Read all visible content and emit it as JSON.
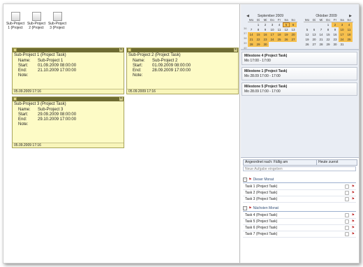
{
  "window": {
    "title": ""
  },
  "projects": [
    {
      "name": "Sub-Project 1 (Project"
    },
    {
      "name": "Sub-Project 2 (Project"
    },
    {
      "name": "Sub-Project 3 (Project"
    }
  ],
  "notes": [
    {
      "title": "Sub-Project 1 (Project Task)",
      "name_label": "Name:",
      "name": "Sub-Project 1",
      "start_label": "Start:",
      "start": "01.09.2009 08:00:00",
      "end_label": "End:",
      "end": "21.10.2009 17:00:00",
      "note_label": "Note:",
      "footer": "05.09.2009 17:16"
    },
    {
      "title": "Sub-Project 2 (Project Task)",
      "name_label": "Name:",
      "name": "Sub-Project 2",
      "start_label": "Start:",
      "start": "01.09.2009 08:00:00",
      "end_label": "End:",
      "end": "28.09.2009 17:00:00",
      "note_label": "Note:",
      "footer": "05.09.2009 17:16"
    },
    {
      "title": "Sub-Project 3 (Project Task)",
      "name_label": "Name:",
      "name": "Sub-Project 3",
      "start_label": "Start:",
      "start": "29.09.2009 08:00:00",
      "end_label": "End:",
      "end": "29.10.2009 17:00:00",
      "note_label": "Note:",
      "footer": "05.09.2009 17:16"
    }
  ],
  "right_pane": {
    "title": ""
  },
  "calendar": {
    "dow": [
      "Mo",
      "Di",
      "Mi",
      "Do",
      "Fr",
      "Sa",
      "So"
    ],
    "months": [
      {
        "label": "September 2009",
        "lead_blank": 1,
        "days": [
          "1",
          "2",
          "3",
          "4",
          "5",
          "6",
          "7",
          "8",
          "9",
          "10",
          "11",
          "12",
          "13",
          "14",
          "15",
          "16",
          "17",
          "18",
          "19",
          "20",
          "21",
          "22",
          "23",
          "24",
          "25",
          "26",
          "27",
          "28",
          "29",
          "30"
        ],
        "highlight": [
          "5",
          "6",
          "14",
          "15",
          "16",
          "17",
          "18",
          "19",
          "20",
          "21",
          "22",
          "23",
          "24",
          "25",
          "26",
          "27",
          "28",
          "29",
          "30"
        ],
        "selected": [
          "5"
        ]
      },
      {
        "label": "Oktober 2009",
        "lead_blank": 3,
        "days": [
          "1",
          "2",
          "3",
          "4",
          "5",
          "6",
          "7",
          "8",
          "9",
          "10",
          "11",
          "12",
          "13",
          "14",
          "15",
          "16",
          "17",
          "18",
          "19",
          "20",
          "21",
          "22",
          "23",
          "24",
          "25",
          "26",
          "27",
          "28",
          "29",
          "30",
          "31"
        ],
        "highlight": [
          "2",
          "3",
          "4",
          "10",
          "11",
          "17",
          "18",
          "24",
          "25"
        ],
        "selected": []
      }
    ],
    "weeks": [
      "36",
      "37",
      "38",
      "39",
      "40",
      "41"
    ]
  },
  "milestones": [
    {
      "title": "Milestone 4 (Project Task)",
      "sub": "Mo 17:00 - 17:00"
    },
    {
      "title": "Milestone 1 (Project Task)",
      "sub": "Mo 28.09 17:00 - 17:00"
    },
    {
      "title": "Milestone 5 (Project Task)",
      "sub": "Mo 28.09 17:00 - 17:00"
    }
  ],
  "tasks_pane": {
    "arrange_label": "Angeordnet nach: Fällig am",
    "sort_label": "Heute zuerst",
    "new_task_placeholder": "Neue Aufgabe eingeben",
    "groups": [
      {
        "label": "Dieser Monat",
        "tasks": [
          "Task 1 (Project Task)",
          "Task 2 (Project Task)",
          "Task 3 (Project Task)"
        ]
      },
      {
        "label": "Nächsten Monat",
        "tasks": [
          "Task 4 (Project Task)",
          "Task 5 (Project Task)",
          "Task 6 (Project Task)",
          "Task 7 (Project Task)"
        ]
      }
    ]
  },
  "colors": {
    "note_bg": "#fdfbc6",
    "note_bar": "#6e6b32",
    "highlight_day": "#f6c04e",
    "pane_bg": "#e9edf4"
  }
}
